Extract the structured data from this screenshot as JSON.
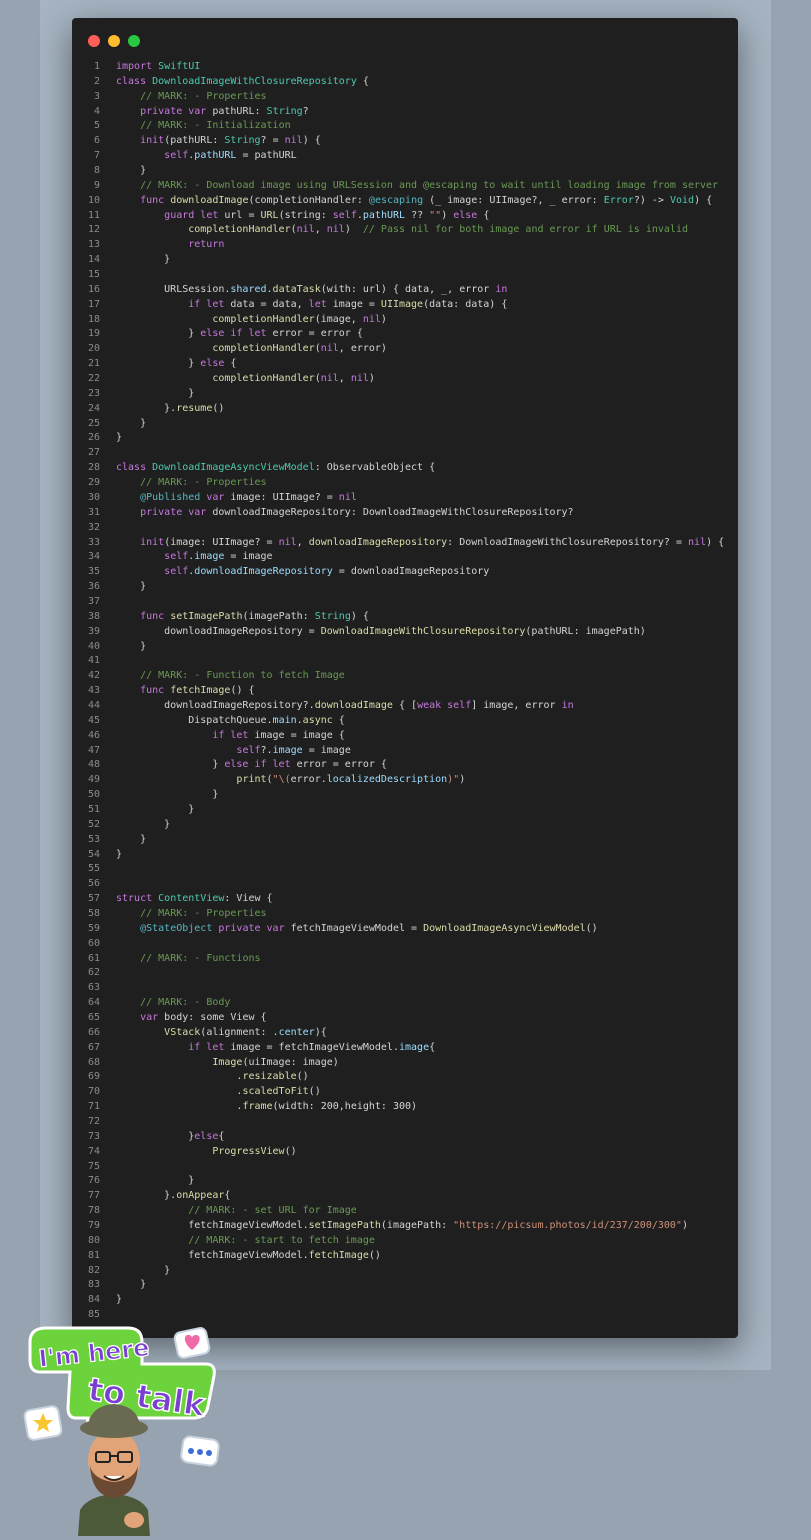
{
  "window": {
    "controls": [
      {
        "name": "close",
        "color": "#ff5f57"
      },
      {
        "name": "minimize",
        "color": "#febc2e"
      },
      {
        "name": "zoom",
        "color": "#28c840"
      }
    ]
  },
  "code_lines": [
    [
      [
        "kw",
        "import"
      ],
      [
        "pl",
        " "
      ],
      [
        "ty",
        "SwiftUI"
      ]
    ],
    [
      [
        "kw",
        "class"
      ],
      [
        "pl",
        " "
      ],
      [
        "ty",
        "DownloadImageWithClosureRepository"
      ],
      [
        "pl",
        " {"
      ]
    ],
    [
      [
        "pl",
        "    "
      ],
      [
        "cm",
        "// MARK: - Properties"
      ]
    ],
    [
      [
        "pl",
        "    "
      ],
      [
        "kw",
        "private var"
      ],
      [
        "pl",
        " pathURL: "
      ],
      [
        "ty",
        "String"
      ],
      [
        "pl",
        "?"
      ]
    ],
    [
      [
        "pl",
        "    "
      ],
      [
        "cm",
        "// MARK: - Initialization"
      ]
    ],
    [
      [
        "pl",
        "    "
      ],
      [
        "kw",
        "init"
      ],
      [
        "pl",
        "(pathURL: "
      ],
      [
        "ty",
        "String"
      ],
      [
        "pl",
        "? = "
      ],
      [
        "kw",
        "nil"
      ],
      [
        "pl",
        ") {"
      ]
    ],
    [
      [
        "pl",
        "        "
      ],
      [
        "kw",
        "self"
      ],
      [
        "pl",
        "."
      ],
      [
        "pr",
        "pathURL"
      ],
      [
        "pl",
        " = pathURL"
      ]
    ],
    [
      [
        "pl",
        "    }"
      ]
    ],
    [
      [
        "pl",
        "    "
      ],
      [
        "cm",
        "// MARK: - Download image using URLSession and @escaping to wait until loading image from server"
      ]
    ],
    [
      [
        "pl",
        "    "
      ],
      [
        "kw",
        "func"
      ],
      [
        "pl",
        " "
      ],
      [
        "fn",
        "downloadImage"
      ],
      [
        "pl",
        "(completionHandler: "
      ],
      [
        "at",
        "@escaping"
      ],
      [
        "pl",
        " (_ image: UIImage?, _ error: "
      ],
      [
        "ty",
        "Error"
      ],
      [
        "pl",
        "?) -> "
      ],
      [
        "ty",
        "Void"
      ],
      [
        "pl",
        ") {"
      ]
    ],
    [
      [
        "pl",
        "        "
      ],
      [
        "kw",
        "guard let"
      ],
      [
        "pl",
        " url = "
      ],
      [
        "fn",
        "URL"
      ],
      [
        "pl",
        "(string: "
      ],
      [
        "kw",
        "self"
      ],
      [
        "pl",
        "."
      ],
      [
        "pr",
        "pathURL"
      ],
      [
        "pl",
        " ?? "
      ],
      [
        "str",
        "\"\""
      ],
      [
        "pl",
        ") "
      ],
      [
        "kw",
        "else"
      ],
      [
        "pl",
        " {"
      ]
    ],
    [
      [
        "pl",
        "            "
      ],
      [
        "fn",
        "completionHandler"
      ],
      [
        "pl",
        "("
      ],
      [
        "kw",
        "nil"
      ],
      [
        "pl",
        ", "
      ],
      [
        "kw",
        "nil"
      ],
      [
        "pl",
        ")  "
      ],
      [
        "cm",
        "// Pass nil for both image and error if URL is invalid"
      ]
    ],
    [
      [
        "pl",
        "            "
      ],
      [
        "kw",
        "return"
      ]
    ],
    [
      [
        "pl",
        "        }"
      ]
    ],
    [],
    [
      [
        "pl",
        "        URLSession."
      ],
      [
        "pr",
        "shared"
      ],
      [
        "pl",
        "."
      ],
      [
        "fn",
        "dataTask"
      ],
      [
        "pl",
        "(with: url) { data, _, error "
      ],
      [
        "kw",
        "in"
      ]
    ],
    [
      [
        "pl",
        "            "
      ],
      [
        "kw",
        "if let"
      ],
      [
        "pl",
        " data = data, "
      ],
      [
        "kw",
        "let"
      ],
      [
        "pl",
        " image = "
      ],
      [
        "fn",
        "UIImage"
      ],
      [
        "pl",
        "(data: data) {"
      ]
    ],
    [
      [
        "pl",
        "                "
      ],
      [
        "fn",
        "completionHandler"
      ],
      [
        "pl",
        "(image, "
      ],
      [
        "kw",
        "nil"
      ],
      [
        "pl",
        ")"
      ]
    ],
    [
      [
        "pl",
        "            } "
      ],
      [
        "kw",
        "else if let"
      ],
      [
        "pl",
        " error = error {"
      ]
    ],
    [
      [
        "pl",
        "                "
      ],
      [
        "fn",
        "completionHandler"
      ],
      [
        "pl",
        "("
      ],
      [
        "kw",
        "nil"
      ],
      [
        "pl",
        ", error)"
      ]
    ],
    [
      [
        "pl",
        "            } "
      ],
      [
        "kw",
        "else"
      ],
      [
        "pl",
        " {"
      ]
    ],
    [
      [
        "pl",
        "                "
      ],
      [
        "fn",
        "completionHandler"
      ],
      [
        "pl",
        "("
      ],
      [
        "kw",
        "nil"
      ],
      [
        "pl",
        ", "
      ],
      [
        "kw",
        "nil"
      ],
      [
        "pl",
        ")"
      ]
    ],
    [
      [
        "pl",
        "            }"
      ]
    ],
    [
      [
        "pl",
        "        }."
      ],
      [
        "fn",
        "resume"
      ],
      [
        "pl",
        "()"
      ]
    ],
    [
      [
        "pl",
        "    }"
      ]
    ],
    [
      [
        "pl",
        "}"
      ]
    ],
    [],
    [
      [
        "kw",
        "class"
      ],
      [
        "pl",
        " "
      ],
      [
        "ty",
        "DownloadImageAsyncViewModel"
      ],
      [
        "pl",
        ": ObservableObject {"
      ]
    ],
    [
      [
        "pl",
        "    "
      ],
      [
        "cm",
        "// MARK: - Properties"
      ]
    ],
    [
      [
        "pl",
        "    "
      ],
      [
        "at",
        "@Published"
      ],
      [
        "pl",
        " "
      ],
      [
        "kw",
        "var"
      ],
      [
        "pl",
        " image: UIImage? = "
      ],
      [
        "kw",
        "nil"
      ]
    ],
    [
      [
        "pl",
        "    "
      ],
      [
        "kw",
        "private var"
      ],
      [
        "pl",
        " downloadImageRepository: DownloadImageWithClosureRepository?"
      ]
    ],
    [],
    [
      [
        "pl",
        "    "
      ],
      [
        "kw",
        "init"
      ],
      [
        "pl",
        "(image: UIImage? = "
      ],
      [
        "kw",
        "nil"
      ],
      [
        "pl",
        ", "
      ],
      [
        "fn",
        "downloadImageRepository"
      ],
      [
        "pl",
        ": DownloadImageWithClosureRepository? = "
      ],
      [
        "kw",
        "nil"
      ],
      [
        "pl",
        ") {"
      ]
    ],
    [
      [
        "pl",
        "        "
      ],
      [
        "kw",
        "self"
      ],
      [
        "pl",
        "."
      ],
      [
        "pr",
        "image"
      ],
      [
        "pl",
        " = image"
      ]
    ],
    [
      [
        "pl",
        "        "
      ],
      [
        "kw",
        "self"
      ],
      [
        "pl",
        "."
      ],
      [
        "pr",
        "downloadImageRepository"
      ],
      [
        "pl",
        " = downloadImageRepository"
      ]
    ],
    [
      [
        "pl",
        "    }"
      ]
    ],
    [],
    [
      [
        "pl",
        "    "
      ],
      [
        "kw",
        "func"
      ],
      [
        "pl",
        " "
      ],
      [
        "fn",
        "setImagePath"
      ],
      [
        "pl",
        "(imagePath: "
      ],
      [
        "ty",
        "String"
      ],
      [
        "pl",
        ") {"
      ]
    ],
    [
      [
        "pl",
        "        downloadImageRepository = "
      ],
      [
        "fn",
        "DownloadImageWithClosureRepository"
      ],
      [
        "pl",
        "(pathURL: imagePath)"
      ]
    ],
    [
      [
        "pl",
        "    }"
      ]
    ],
    [],
    [
      [
        "pl",
        "    "
      ],
      [
        "cm",
        "// MARK: - Function to fetch Image"
      ]
    ],
    [
      [
        "pl",
        "    "
      ],
      [
        "kw",
        "func"
      ],
      [
        "pl",
        " "
      ],
      [
        "fn",
        "fetchImage"
      ],
      [
        "pl",
        "() {"
      ]
    ],
    [
      [
        "pl",
        "        downloadImageRepository?."
      ],
      [
        "fn",
        "downloadImage"
      ],
      [
        "pl",
        " { ["
      ],
      [
        "kw",
        "weak self"
      ],
      [
        "pl",
        "] image, error "
      ],
      [
        "kw",
        "in"
      ]
    ],
    [
      [
        "pl",
        "            DispatchQueue."
      ],
      [
        "pr",
        "main"
      ],
      [
        "pl",
        "."
      ],
      [
        "fn",
        "async"
      ],
      [
        "pl",
        " {"
      ]
    ],
    [
      [
        "pl",
        "                "
      ],
      [
        "kw",
        "if let"
      ],
      [
        "pl",
        " image = image {"
      ]
    ],
    [
      [
        "pl",
        "                    "
      ],
      [
        "kw",
        "self"
      ],
      [
        "pl",
        "?."
      ],
      [
        "pr",
        "image"
      ],
      [
        "pl",
        " = image"
      ]
    ],
    [
      [
        "pl",
        "                } "
      ],
      [
        "kw",
        "else if let"
      ],
      [
        "pl",
        " error = error {"
      ]
    ],
    [
      [
        "pl",
        "                    "
      ],
      [
        "fn",
        "print"
      ],
      [
        "pl",
        "("
      ],
      [
        "str",
        "\"\\("
      ],
      [
        "pl",
        "error."
      ],
      [
        "pr",
        "localizedDescription"
      ],
      [
        "str",
        ")\""
      ],
      [
        "pl",
        ")"
      ]
    ],
    [
      [
        "pl",
        "                }"
      ]
    ],
    [
      [
        "pl",
        "            }"
      ]
    ],
    [
      [
        "pl",
        "        }"
      ]
    ],
    [
      [
        "pl",
        "    }"
      ]
    ],
    [
      [
        "pl",
        "}"
      ]
    ],
    [],
    [],
    [
      [
        "kw",
        "struct"
      ],
      [
        "pl",
        " "
      ],
      [
        "ty",
        "ContentView"
      ],
      [
        "pl",
        ": View {"
      ]
    ],
    [
      [
        "pl",
        "    "
      ],
      [
        "cm",
        "// MARK: - Properties"
      ]
    ],
    [
      [
        "pl",
        "    "
      ],
      [
        "at",
        "@StateObject"
      ],
      [
        "pl",
        " "
      ],
      [
        "kw",
        "private var"
      ],
      [
        "pl",
        " fetchImageViewModel = "
      ],
      [
        "fn",
        "DownloadImageAsyncViewModel"
      ],
      [
        "pl",
        "()"
      ]
    ],
    [],
    [
      [
        "pl",
        "    "
      ],
      [
        "cm",
        "// MARK: - Functions"
      ]
    ],
    [],
    [],
    [
      [
        "pl",
        "    "
      ],
      [
        "cm",
        "// MARK: - Body"
      ]
    ],
    [
      [
        "pl",
        "    "
      ],
      [
        "kw",
        "var"
      ],
      [
        "pl",
        " body: some View {"
      ]
    ],
    [
      [
        "pl",
        "        "
      ],
      [
        "fn",
        "VStack"
      ],
      [
        "pl",
        "(alignment: ."
      ],
      [
        "pr",
        "center"
      ],
      [
        "pl",
        "){"
      ]
    ],
    [
      [
        "pl",
        "            "
      ],
      [
        "kw",
        "if let"
      ],
      [
        "pl",
        " image = fetchImageViewModel."
      ],
      [
        "pr",
        "image"
      ],
      [
        "pl",
        "{"
      ]
    ],
    [
      [
        "pl",
        "                "
      ],
      [
        "fn",
        "Image"
      ],
      [
        "pl",
        "(uiImage: image)"
      ]
    ],
    [
      [
        "pl",
        "                    ."
      ],
      [
        "fn",
        "resizable"
      ],
      [
        "pl",
        "()"
      ]
    ],
    [
      [
        "pl",
        "                    ."
      ],
      [
        "fn",
        "scaledToFit"
      ],
      [
        "pl",
        "()"
      ]
    ],
    [
      [
        "pl",
        "                    ."
      ],
      [
        "fn",
        "frame"
      ],
      [
        "pl",
        "(width: 200,height: 300)"
      ]
    ],
    [],
    [
      [
        "pl",
        "            }"
      ],
      [
        "kw",
        "else"
      ],
      [
        "pl",
        "{"
      ]
    ],
    [
      [
        "pl",
        "                "
      ],
      [
        "fn",
        "ProgressView"
      ],
      [
        "pl",
        "()"
      ]
    ],
    [],
    [
      [
        "pl",
        "            }"
      ]
    ],
    [
      [
        "pl",
        "        }."
      ],
      [
        "fn",
        "onAppear"
      ],
      [
        "pl",
        "{"
      ]
    ],
    [
      [
        "pl",
        "            "
      ],
      [
        "cm",
        "// MARK: - set URL for Image"
      ]
    ],
    [
      [
        "pl",
        "            fetchImageViewModel."
      ],
      [
        "fn",
        "setImagePath"
      ],
      [
        "pl",
        "(imagePath: "
      ],
      [
        "str",
        "\"https://picsum.photos/id/237/200/300\""
      ],
      [
        "pl",
        ")"
      ]
    ],
    [
      [
        "pl",
        "            "
      ],
      [
        "cm",
        "// MARK: - start to fetch image"
      ]
    ],
    [
      [
        "pl",
        "            fetchImageViewModel."
      ],
      [
        "fn",
        "fetchImage"
      ],
      [
        "pl",
        "()"
      ]
    ],
    [
      [
        "pl",
        "        }"
      ]
    ],
    [
      [
        "pl",
        "    }"
      ]
    ],
    [
      [
        "pl",
        "}"
      ]
    ],
    []
  ],
  "sticker": {
    "text_line1": "I'm here",
    "text_line2": "to talk",
    "icons": [
      "heart-icon",
      "star-icon",
      "ellipsis-icon"
    ]
  },
  "colors": {
    "page_background": "#97a3b0",
    "editor_background": "#1f1f1f",
    "sticker_green": "#6dd33c"
  }
}
